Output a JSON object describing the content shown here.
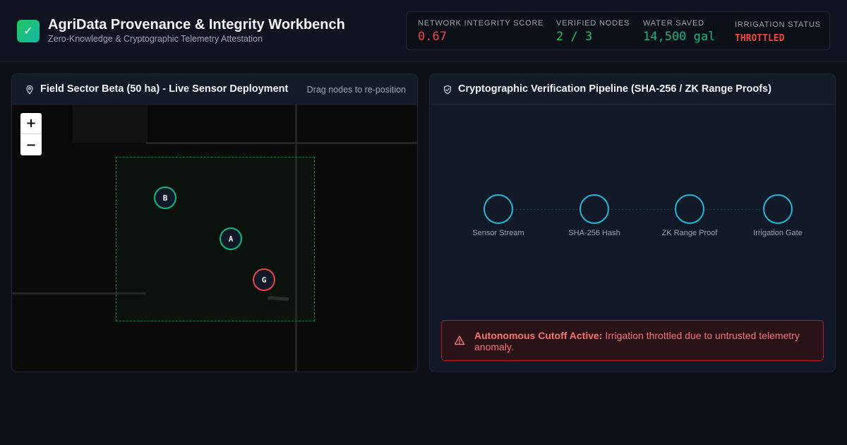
{
  "header": {
    "logo_glyph": "✓",
    "title": "AgriData Provenance & Integrity Workbench",
    "subtitle": "Zero-Knowledge & Cryptographic Telemetry Attestation"
  },
  "metrics": [
    {
      "label": "Network Integrity Score",
      "value": "0.67",
      "color": "#ef4444"
    },
    {
      "label": "Verified Nodes",
      "value": "2 / 3",
      "color": "#22c55e"
    },
    {
      "label": "Water Saved",
      "value": "14,500 gal",
      "color": "#10b981"
    },
    {
      "label": "Irrigation Status",
      "value": "THROTTLED",
      "color": "#ef4444"
    }
  ],
  "map_panel": {
    "title": "Field Sector Beta (50 ha) - Live Sensor Deployment",
    "hint": "Drag nodes to re-position",
    "icon": "map-pin-icon",
    "zoom_in": "+",
    "zoom_out": "−",
    "nodes": [
      {
        "label": "B",
        "status": "verified"
      },
      {
        "label": "A",
        "status": "verified"
      },
      {
        "label": "G",
        "status": "untrusted"
      }
    ]
  },
  "pipeline_panel": {
    "title": "Cryptographic Verification Pipeline (SHA-256 / ZK Range Proofs)",
    "icon": "shield-check-icon",
    "stages": [
      "Sensor Stream",
      "SHA-256 Hash",
      "ZK Range Proof",
      "Irrigation Gate"
    ],
    "alert": {
      "icon": "warning-icon",
      "title": "Autonomous Cutoff Active:",
      "message": "Irrigation throttled due to untrusted telemetry anomaly."
    }
  },
  "colors": {
    "verified": "#10b981",
    "untrusted": "#ef4444",
    "pipeline": "#22b8d8"
  }
}
